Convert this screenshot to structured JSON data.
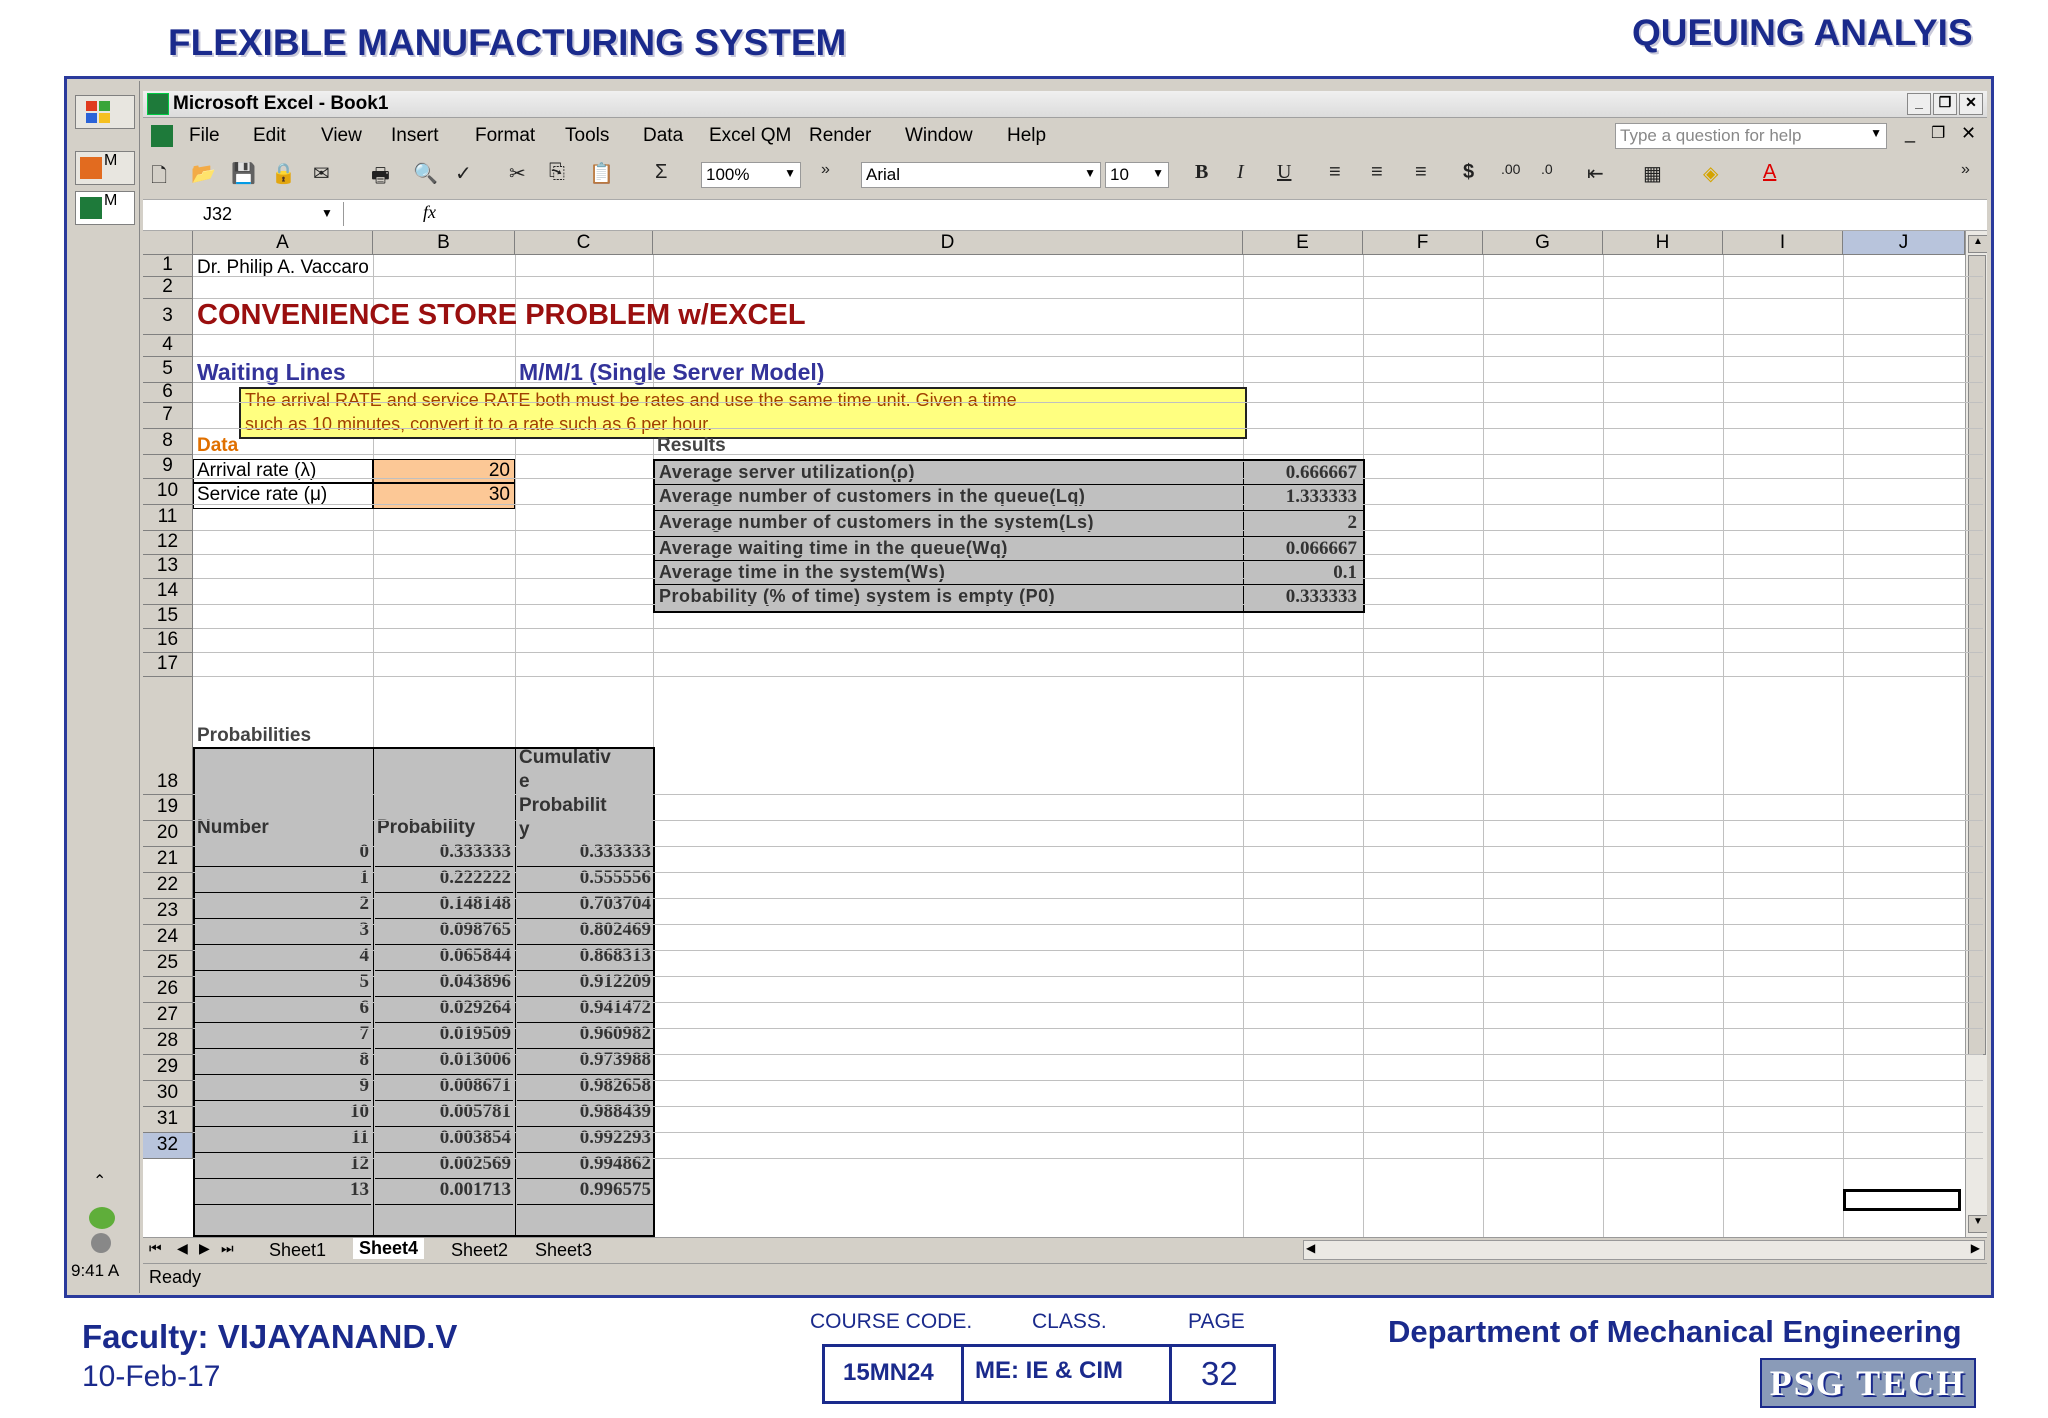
{
  "slide": {
    "title_left": "FLEXIBLE MANUFACTURING SYSTEM",
    "title_right": "QUEUING ANALYIS",
    "faculty": "Faculty: VIJAYANAND.V",
    "date": "10-Feb-17",
    "course_code_label": "COURSE CODE.",
    "class_label": "CLASS.",
    "page_label": "PAGE",
    "course_code": "15MN24",
    "class": "ME: IE & CIM",
    "page": "32",
    "department": "Department of Mechanical Engineering",
    "logo_text": "PSG TECH"
  },
  "taskbar": {
    "btn1": "M",
    "btn2": "M",
    "clock": "9:41 A"
  },
  "excel": {
    "title": "Microsoft Excel - Book1",
    "menu": [
      "File",
      "Edit",
      "View",
      "Insert",
      "Format",
      "Tools",
      "Data",
      "Excel QM",
      "Render",
      "Window",
      "Help"
    ],
    "help_placeholder": "Type a question for help",
    "zoom": "100%",
    "font": "Arial",
    "font_size": "10",
    "name_box": "J32",
    "fx": "fx",
    "columns": [
      "A",
      "B",
      "C",
      "D",
      "E",
      "F",
      "G",
      "H",
      "I",
      "J"
    ],
    "status": "Ready",
    "sheets": [
      "Sheet1",
      "Sheet4",
      "Sheet2",
      "Sheet3"
    ]
  },
  "sheet": {
    "a1": "Dr. Philip A. Vaccaro",
    "a3": "CONVENIENCE STORE PROBLEM w/EXCEL",
    "a5": "Waiting Lines",
    "c5": "M/M/1 (Single Server Model)",
    "note_line1": "The arrival RATE and service RATE both must be rates and use the same time unit. Given a time",
    "note_line2": "such as 10 minutes, convert it to a rate such as 6 per hour.",
    "a8": "Data",
    "d8": "Results",
    "arrival_label": "Arrival rate (λ)",
    "arrival_value": "20",
    "service_label": "Service rate (μ)",
    "service_value": "30",
    "results": [
      {
        "label": "Average server utilization(ρ)",
        "value": "0.666667"
      },
      {
        "label": "Average number of customers in the queue(Lq)",
        "value": "1.333333"
      },
      {
        "label": "Average number of customers in the system(Ls)",
        "value": "2"
      },
      {
        "label": "Average waiting time in the queue(Wq)",
        "value": "0.066667"
      },
      {
        "label": "Average time in the system(Ws)",
        "value": "0.1"
      },
      {
        "label": "Probability (% of time) system is empty (P0)",
        "value": "0.333333"
      }
    ],
    "a17": "Probabilities",
    "hdr_number": "Number",
    "hdr_probability": "Probability",
    "hdr_cumulative_1": "Cumulativ",
    "hdr_cumulative_2": "e",
    "hdr_cumulative_3": "Probabilit",
    "hdr_cumulative_4": "y",
    "prob_rows": [
      [
        "0",
        "0.333333",
        "0.333333"
      ],
      [
        "1",
        "0.222222",
        "0.555556"
      ],
      [
        "2",
        "0.148148",
        "0.703704"
      ],
      [
        "3",
        "0.098765",
        "0.802469"
      ],
      [
        "4",
        "0.065844",
        "0.868313"
      ],
      [
        "5",
        "0.043896",
        "0.912209"
      ],
      [
        "6",
        "0.029264",
        "0.941472"
      ],
      [
        "7",
        "0.019509",
        "0.960982"
      ],
      [
        "8",
        "0.013006",
        "0.973988"
      ],
      [
        "9",
        "0.008671",
        "0.982658"
      ],
      [
        "10",
        "0.005781",
        "0.988439"
      ],
      [
        "11",
        "0.003854",
        "0.992293"
      ],
      [
        "12",
        "0.002569",
        "0.994862"
      ],
      [
        "13",
        "0.001713",
        "0.996575"
      ]
    ],
    "row_numbers": [
      "1",
      "2",
      "3",
      "4",
      "5",
      "6",
      "7",
      "8",
      "9",
      "10",
      "11",
      "12",
      "13",
      "14",
      "15",
      "16",
      "17",
      "18",
      "19",
      "20",
      "21",
      "22",
      "23",
      "24",
      "25",
      "26",
      "27",
      "28",
      "29",
      "30",
      "31",
      "32"
    ]
  }
}
